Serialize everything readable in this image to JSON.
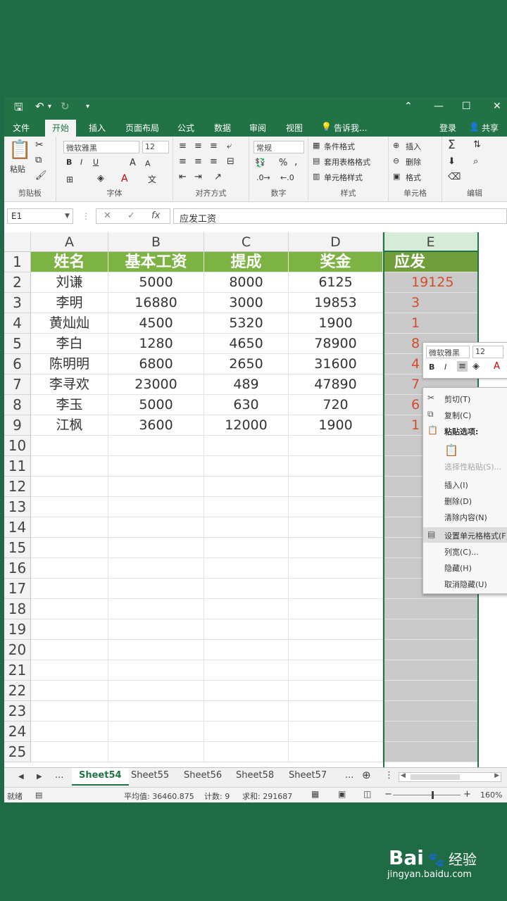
{
  "quick_access": {
    "redo_label": "↻"
  },
  "titlebar": {
    "window_buttons": [
      "—",
      "☐",
      "✕"
    ]
  },
  "tabs": [
    {
      "label": "文件"
    },
    {
      "label": "开始"
    },
    {
      "label": "插入"
    },
    {
      "label": "页面布局"
    },
    {
      "label": "公式"
    },
    {
      "label": "数据"
    },
    {
      "label": "审阅"
    },
    {
      "label": "视图"
    }
  ],
  "tell_me": "告诉我...",
  "login": "登录",
  "share": "共享",
  "ribbon": {
    "clipboard": {
      "paste": "粘贴",
      "label": "剪贴板"
    },
    "font": {
      "name": "微软雅黑",
      "size": "12",
      "bold": "B",
      "italic": "I",
      "underline": "U",
      "grow": "A",
      "shrink": "A",
      "label": "字体"
    },
    "alignment": {
      "label": "对齐方式"
    },
    "number": {
      "format": "常规",
      "percent": "%",
      "comma": ",",
      "label": "数字"
    },
    "styles": {
      "conditional": "条件格式",
      "table": "套用表格格式",
      "cell": "单元格样式",
      "label": "样式"
    },
    "cells": {
      "insert": "插入",
      "delete": "删除",
      "format": "格式",
      "label": "单元格"
    },
    "editing": {
      "label": "编辑"
    }
  },
  "formula_bar": {
    "name_box": "E1",
    "cancel": "✕",
    "enter": "✓",
    "fx": "fx",
    "value": "应发工资"
  },
  "columns": [
    "A",
    "B",
    "C",
    "D",
    "E"
  ],
  "table": {
    "headers": [
      "姓名",
      "基本工资",
      "提成",
      "奖金",
      "应发"
    ],
    "rows": [
      [
        "刘谦",
        "5000",
        "8000",
        "6125",
        "19125"
      ],
      [
        "李明",
        "16880",
        "3000",
        "19853",
        "3"
      ],
      [
        "黄灿灿",
        "4500",
        "5320",
        "1900",
        "1"
      ],
      [
        "李白",
        "1280",
        "4650",
        "78900",
        "8"
      ],
      [
        "陈明明",
        "6800",
        "2650",
        "31600",
        "4"
      ],
      [
        "李寻欢",
        "23000",
        "489",
        "47890",
        "7"
      ],
      [
        "李玉",
        "5000",
        "630",
        "720",
        "6"
      ],
      [
        "江枫",
        "3600",
        "12000",
        "1900",
        "1"
      ]
    ]
  },
  "row_numbers": [
    "1",
    "2",
    "3",
    "4",
    "5",
    "6",
    "7",
    "8",
    "9",
    "10",
    "11",
    "12",
    "13",
    "14",
    "15",
    "16",
    "17",
    "18",
    "19",
    "20",
    "21",
    "22",
    "23",
    "24",
    "25"
  ],
  "sheet_tabs": {
    "active": "Sheet54",
    "others": [
      "Sheet55",
      "Sheet56",
      "Sheet58",
      "Sheet57"
    ],
    "ellipsis": "..."
  },
  "status": {
    "ready": "就绪",
    "average": "平均值: 36460.875",
    "count": "计数: 9",
    "sum": "求和: 291687",
    "zoom": "160%"
  },
  "mini_toolbar": {
    "font": "微软雅黑",
    "size": "12",
    "bold": "B",
    "italic": "I"
  },
  "context_menu": [
    {
      "label": "剪切(T)",
      "icon": "scissors-icon"
    },
    {
      "label": "复制(C)",
      "icon": "copy-icon"
    },
    {
      "label": "粘贴选项:",
      "icon": "paste-icon",
      "bold": true
    },
    {
      "label": "",
      "icon": "clipboard-icon",
      "disabled": true
    },
    {
      "label": "选择性粘贴(S)...",
      "icon": "",
      "disabled": true
    },
    {
      "label": "插入(I)",
      "icon": ""
    },
    {
      "label": "删除(D)",
      "icon": ""
    },
    {
      "label": "清除内容(N)",
      "icon": ""
    },
    {
      "label": "设置单元格格式(F)...",
      "icon": "format-cells-icon",
      "highlight": true
    },
    {
      "label": "列宽(C)...",
      "icon": ""
    },
    {
      "label": "隐藏(H)",
      "icon": ""
    },
    {
      "label": "取消隐藏(U)",
      "icon": ""
    }
  ],
  "watermark": {
    "brand": "Bai",
    "brand2": "经验",
    "url": "jingyan.baidu.com"
  },
  "colors": {
    "excel_green": "#217346",
    "header_fill": "#7cb342",
    "accent_red": "#d34d2d",
    "background": "#1e6b45"
  }
}
